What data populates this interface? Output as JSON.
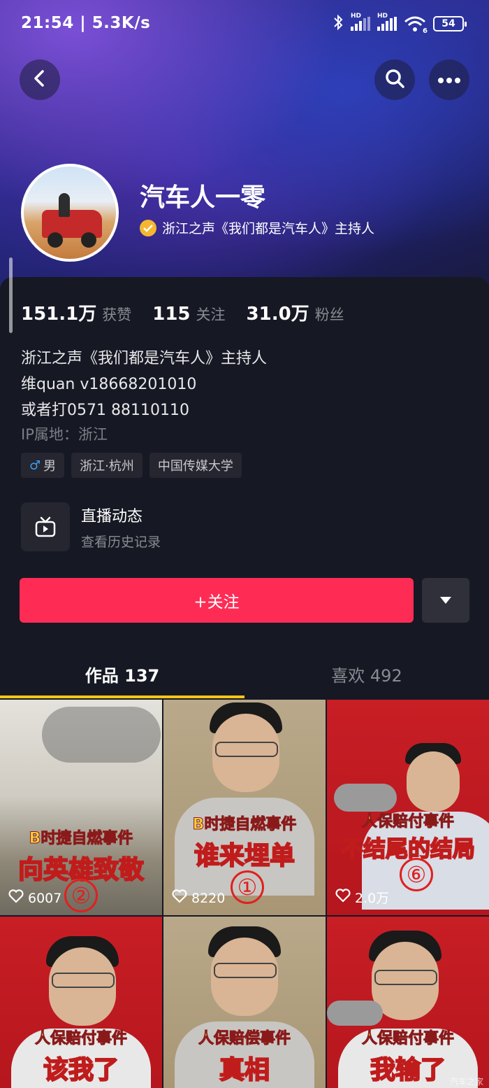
{
  "status": {
    "time": "21:54 | 5.3K/s",
    "battery": "54",
    "hd1": "HD",
    "hd2": "HD",
    "wifi_badge": "6"
  },
  "profile": {
    "name": "汽车人一零",
    "verified_text": "浙江之声《我们都是汽车人》主持人"
  },
  "stats": [
    {
      "num": "151.1万",
      "label": "获赞"
    },
    {
      "num": "115",
      "label": "关注"
    },
    {
      "num": "31.0万",
      "label": "粉丝"
    }
  ],
  "bio": {
    "line1": "浙江之声《我们都是汽车人》主持人",
    "line2": "维quan v18668201010",
    "line3": "或者打0571 88110110",
    "ip": "IP属地：浙江"
  },
  "tags": {
    "gender_symbol": "♂",
    "gender": "男",
    "location": "浙江·杭州",
    "school": "中国传媒大学"
  },
  "live": {
    "title": "直播动态",
    "subtitle": "查看历史记录"
  },
  "actions": {
    "follow": "+关注"
  },
  "tabs": {
    "works": "作品 137",
    "likes": "喜欢 492"
  },
  "videos": [
    {
      "cap1": "B时捷自燃事件",
      "cap2": "向英雄致敬",
      "likes": "6007",
      "badge": "②"
    },
    {
      "cap1": "B时捷自燃事件",
      "cap2": "谁来埋单",
      "likes": "8220",
      "badge": "①"
    },
    {
      "cap1": "人保赔付事件",
      "cap2": "不结尾的结局",
      "likes": "2.0万",
      "badge": "⑥"
    },
    {
      "cap1": "人保赔付事件",
      "cap2": "该我了"
    },
    {
      "cap1": "人保赔偿事件",
      "cap2": "真相"
    },
    {
      "cap1": "人保赔付事件",
      "cap2": "我输了"
    }
  ],
  "watermark": "汽车之家",
  "colors": {
    "follow": "#fe2c55",
    "tab_indicator": "#f5c518",
    "background": "#161823",
    "verified_badge": "#f5b731"
  }
}
